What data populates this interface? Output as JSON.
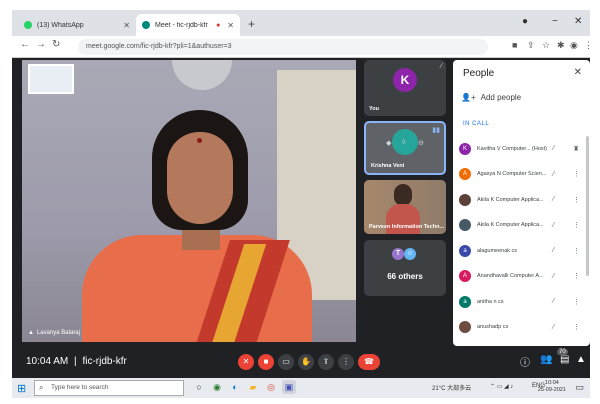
{
  "browser": {
    "tabs": [
      {
        "title": "(13) WhatsApp",
        "color": "#25d366"
      },
      {
        "title": "Meet - fic-rjdb-kfr",
        "color": "#00897b"
      }
    ],
    "new_tab": "+",
    "url": "meet.google.com/fic-rjdb-kfr?pli=1&authuser=3"
  },
  "meeting": {
    "code": "fic-rjdb-kfr",
    "time": "10:04 AM",
    "separator": "|",
    "main_speaker": "Lavanya Balaraj"
  },
  "tiles": [
    {
      "label": "You",
      "initial": "K",
      "avatar_color": "#8e24aa"
    },
    {
      "label": "Krishna Veni"
    },
    {
      "label": "Parveen Information Techn..."
    },
    {
      "label": "66 others",
      "mini": [
        "T",
        "☺"
      ]
    }
  ],
  "people_panel": {
    "title": "People",
    "add_label": "Add people",
    "section": "IN CALL",
    "participants": [
      {
        "name": "Kavitha V Computer... (Host)",
        "initial": "K",
        "color": "#8e24aa"
      },
      {
        "name": "Agasya N Computer Scien...",
        "initial": "A",
        "color": "#ef6c00"
      },
      {
        "name": "Akila K Computer Applica...",
        "initial": "",
        "color": "#5d4037"
      },
      {
        "name": "Akila K Computer Applica...",
        "initial": "",
        "color": "#455a64"
      },
      {
        "name": "alagumeenak cs",
        "initial": "a",
        "color": "#3949ab"
      },
      {
        "name": "Anandhavalli Computer A...",
        "initial": "A",
        "color": "#d81b60"
      },
      {
        "name": "anitha n cs",
        "initial": "a",
        "color": "#00796b"
      },
      {
        "name": "anushadp cs",
        "initial": "",
        "color": "#6d4c41"
      }
    ]
  },
  "controls": {
    "bottom_right_count": "70"
  },
  "taskbar": {
    "search_placeholder": "Type here to search",
    "weather": "21°C 大部多云",
    "lang": "ENG",
    "clock_time": "10:04",
    "clock_date": "25-09-2021"
  }
}
